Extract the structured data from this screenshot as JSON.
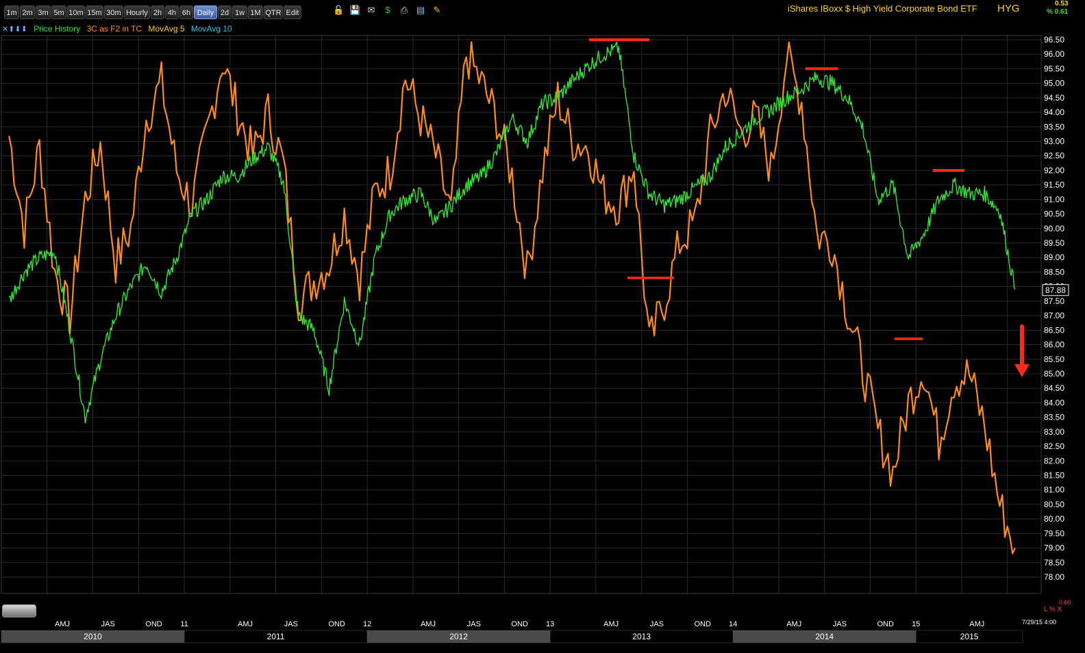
{
  "toolbar": {
    "timeframes": [
      "1m",
      "2m",
      "3m",
      "5m",
      "10m",
      "15m",
      "30m",
      "Hourly",
      "2h",
      "4h",
      "6h",
      "Daily",
      "2d",
      "1w",
      "1M",
      "QTR",
      "Edit"
    ],
    "active": "Daily"
  },
  "header": {
    "title": "iShares IBoxx $ High Yield Corporate Bond ETF",
    "symbol": "HYG",
    "pct_top": "0.53",
    "pct_bottom": "% 0.61"
  },
  "legend": {
    "arrows": "✕⬆⬇⬇",
    "price": "Price History",
    "indicator": "3C as F2 in TC",
    "ma5": "MovAvg 5",
    "ma10": "MovAvg 10"
  },
  "colors": {
    "price": "#33e633",
    "indicator": "#ff8c1a",
    "annotation": "#ff2a1a",
    "ma5": "#ffd400",
    "ma10": "#20c8e8",
    "grid": "#2b2b2b"
  },
  "footer": {
    "right1": "0.60",
    "right2": "L % X",
    "date": "7/29/15 4:00"
  },
  "chart_data": {
    "type": "line",
    "title": "iShares IBoxx $ High Yield Corporate Bond ETF",
    "ylim": [
      77.8,
      96.8
    ],
    "y_ticks": [
      "96.50",
      "96.00",
      "95.50",
      "95.00",
      "94.50",
      "94.00",
      "93.50",
      "93.00",
      "92.50",
      "92.00",
      "91.50",
      "91.00",
      "90.50",
      "90.00",
      "89.50",
      "89.00",
      "88.50",
      "88.00",
      "87.50",
      "87.00",
      "86.50",
      "86.00",
      "85.50",
      "85.00",
      "84.50",
      "84.00",
      "83.50",
      "83.00",
      "82.50",
      "82.00",
      "81.50",
      "81.00",
      "80.50",
      "80.00",
      "79.50",
      "79.00",
      "78.50",
      "78.00"
    ],
    "last_price": "87.88",
    "x_ticks": [
      "AMJ",
      "JAS",
      "OND",
      "11",
      "AMJ",
      "JAS",
      "OND",
      "12",
      "AMJ",
      "JAS",
      "OND",
      "13",
      "AMJ",
      "JAS",
      "OND",
      "14",
      "AMJ",
      "JAS",
      "OND",
      "15",
      "AMJ"
    ],
    "years": [
      "2010",
      "2011",
      "2012",
      "2013",
      "2014",
      "2015"
    ],
    "series": [
      {
        "name": "Price History",
        "x": [
          "2010-01",
          "2010-02",
          "2010-03",
          "2010-04",
          "2010-05",
          "2010-06",
          "2010-07",
          "2010-08",
          "2010-09",
          "2010-10",
          "2010-11",
          "2010-12",
          "2011-01",
          "2011-02",
          "2011-03",
          "2011-04",
          "2011-05",
          "2011-06",
          "2011-07",
          "2011-08",
          "2011-09",
          "2011-10",
          "2011-11",
          "2011-12",
          "2012-01",
          "2012-02",
          "2012-03",
          "2012-04",
          "2012-05",
          "2012-06",
          "2012-07",
          "2012-08",
          "2012-09",
          "2012-10",
          "2012-11",
          "2012-12",
          "2013-01",
          "2013-02",
          "2013-03",
          "2013-04",
          "2013-05",
          "2013-06",
          "2013-07",
          "2013-08",
          "2013-09",
          "2013-10",
          "2013-11",
          "2013-12",
          "2014-01",
          "2014-02",
          "2014-03",
          "2014-04",
          "2014-05",
          "2014-06",
          "2014-07",
          "2014-08",
          "2014-09",
          "2014-10",
          "2014-11",
          "2014-12",
          "2015-01",
          "2015-02",
          "2015-03",
          "2015-04",
          "2015-05",
          "2015-06",
          "2015-07"
        ],
        "values": [
          87.5,
          88.5,
          89.0,
          89.2,
          86.5,
          83.5,
          85.5,
          87.0,
          88.0,
          88.8,
          87.8,
          89.0,
          90.5,
          91.0,
          91.8,
          91.8,
          92.4,
          92.8,
          91.6,
          87.0,
          86.5,
          84.5,
          87.5,
          86.0,
          89.0,
          90.5,
          91.0,
          91.2,
          90.2,
          90.8,
          91.5,
          91.8,
          92.6,
          93.8,
          93.0,
          94.3,
          94.5,
          95.1,
          95.6,
          96.0,
          96.2,
          92.5,
          91.2,
          90.8,
          91.0,
          91.4,
          91.8,
          92.8,
          93.3,
          93.8,
          94.1,
          94.5,
          94.8,
          95.2,
          95.0,
          94.5,
          93.5,
          91.0,
          91.5,
          89.0,
          89.8,
          91.0,
          91.5,
          91.2,
          91.2,
          90.6,
          87.9
        ]
      },
      {
        "name": "3C as F2 in TC",
        "x": [
          "2010-01",
          "2010-02",
          "2010-03",
          "2010-04",
          "2010-05",
          "2010-06",
          "2010-07",
          "2010-08",
          "2010-09",
          "2010-10",
          "2010-11",
          "2010-12",
          "2011-01",
          "2011-02",
          "2011-03",
          "2011-04",
          "2011-05",
          "2011-06",
          "2011-07",
          "2011-08",
          "2011-09",
          "2011-10",
          "2011-11",
          "2011-12",
          "2012-01",
          "2012-02",
          "2012-03",
          "2012-04",
          "2012-05",
          "2012-06",
          "2012-07",
          "2012-08",
          "2012-09",
          "2012-10",
          "2012-11",
          "2012-12",
          "2013-01",
          "2013-02",
          "2013-03",
          "2013-04",
          "2013-05",
          "2013-06",
          "2013-07",
          "2013-08",
          "2013-09",
          "2013-10",
          "2013-11",
          "2013-12",
          "2014-01",
          "2014-02",
          "2014-03",
          "2014-04",
          "2014-05",
          "2014-06",
          "2014-07",
          "2014-08",
          "2014-09",
          "2014-10",
          "2014-11",
          "2014-12",
          "2015-01",
          "2015-02",
          "2015-03",
          "2015-04",
          "2015-05",
          "2015-06",
          "2015-07"
        ],
        "values": [
          93.2,
          90.0,
          92.8,
          88.5,
          87.0,
          91.0,
          92.9,
          88.8,
          90.0,
          93.8,
          95.0,
          92.0,
          90.8,
          93.3,
          95.8,
          94.0,
          92.5,
          94.0,
          92.2,
          87.5,
          88.2,
          88.8,
          90.5,
          88.3,
          91.2,
          92.0,
          95.2,
          93.8,
          92.5,
          90.5,
          96.0,
          95.0,
          93.8,
          91.8,
          88.5,
          92.0,
          94.5,
          93.0,
          92.8,
          91.2,
          90.8,
          92.2,
          86.0,
          87.5,
          89.5,
          90.2,
          93.2,
          94.8,
          93.3,
          93.8,
          92.0,
          95.9,
          94.4,
          89.8,
          89.5,
          87.2,
          85.2,
          83.0,
          81.6,
          84.0,
          85.2,
          82.7,
          84.8,
          85.0,
          83.2,
          80.5,
          79.0
        ]
      }
    ],
    "annotations": {
      "price_highs": [
        96.5,
        95.5,
        92.0
      ],
      "price_lows": [
        88.3,
        86.2
      ],
      "arrow": "down"
    }
  }
}
